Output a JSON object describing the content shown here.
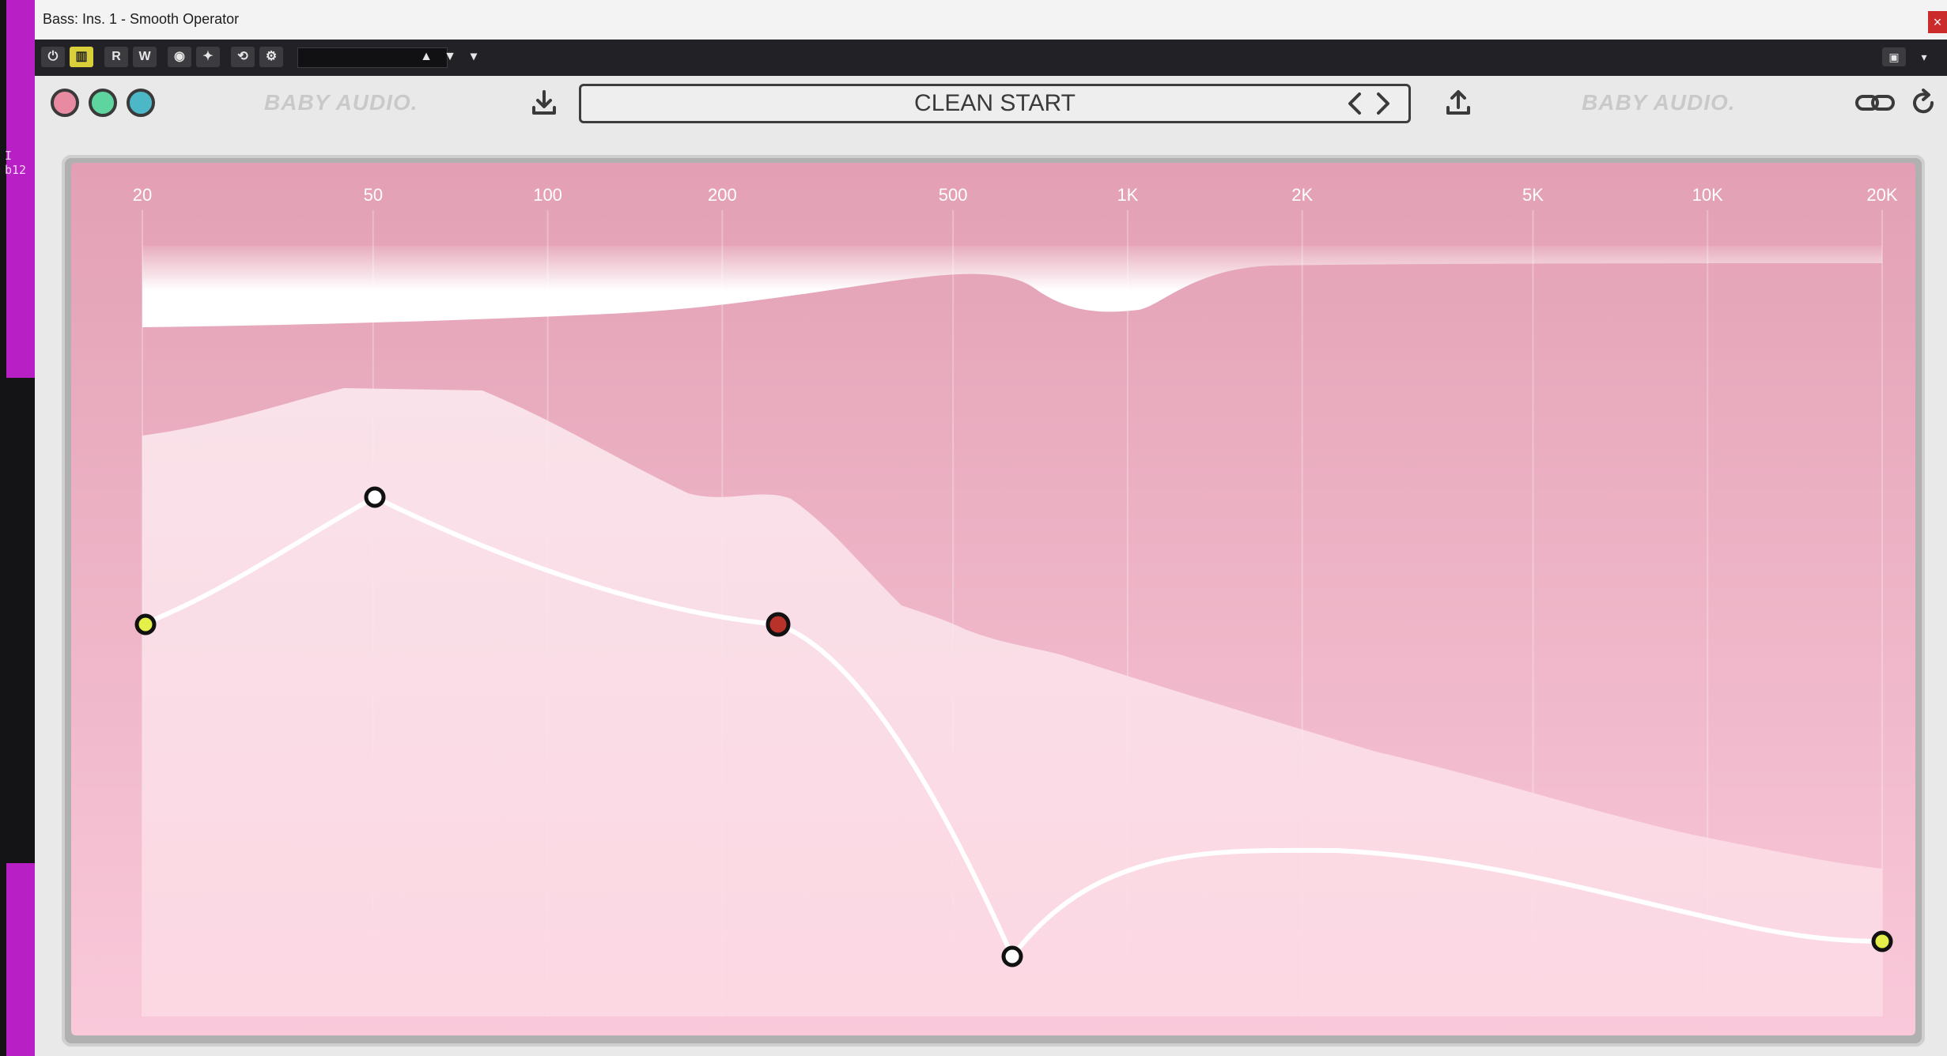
{
  "window": {
    "title": "Bass: Ins. 1 - Smooth Operator",
    "close_glyph": "×"
  },
  "daw": {
    "clip_label": "I b12"
  },
  "toolbar": {
    "power_glyph": "⏻",
    "bypass_glyph": "▥",
    "read_label": "R",
    "write_label": "W",
    "compare_glyph": "◉",
    "plus_glyph": "✦",
    "sync_glyph": "⟲",
    "settings_glyph": "⚙",
    "up_glyph": "▲",
    "down_glyph": "▼",
    "menu_glyph": "▾",
    "camera_glyph": "▣",
    "right_menu_glyph": "▾"
  },
  "plugin": {
    "brand_left": "BABY AUDIO.",
    "brand_right": "BABY AUDIO.",
    "preset": "CLEAN START",
    "mode_dots": [
      {
        "color": "#e98aa3",
        "label": "pink"
      },
      {
        "color": "#5ed59e",
        "label": "green"
      },
      {
        "color": "#4cb7c6",
        "label": "teal"
      }
    ]
  },
  "eq": {
    "freq_axis": {
      "scale": "log",
      "range_hz": [
        20,
        20000
      ]
    },
    "freq_labels": [
      "20",
      "50",
      "100",
      "200",
      "500",
      "1K",
      "2K",
      "5K",
      "10K",
      "20K"
    ],
    "nodes": [
      {
        "type": "low-shelf",
        "state": "yellow"
      },
      {
        "type": "bell",
        "state": "white"
      },
      {
        "type": "bell",
        "state": "selected"
      },
      {
        "type": "notch",
        "state": "white"
      },
      {
        "type": "high-shelf",
        "state": "yellow"
      }
    ],
    "colors": {
      "background_top": "#e4a2b6",
      "background_bottom": "#f7c6d7",
      "curve": "#ffffff",
      "node_yellow": "#e4ef4a",
      "node_selected": "#b8322a"
    }
  }
}
